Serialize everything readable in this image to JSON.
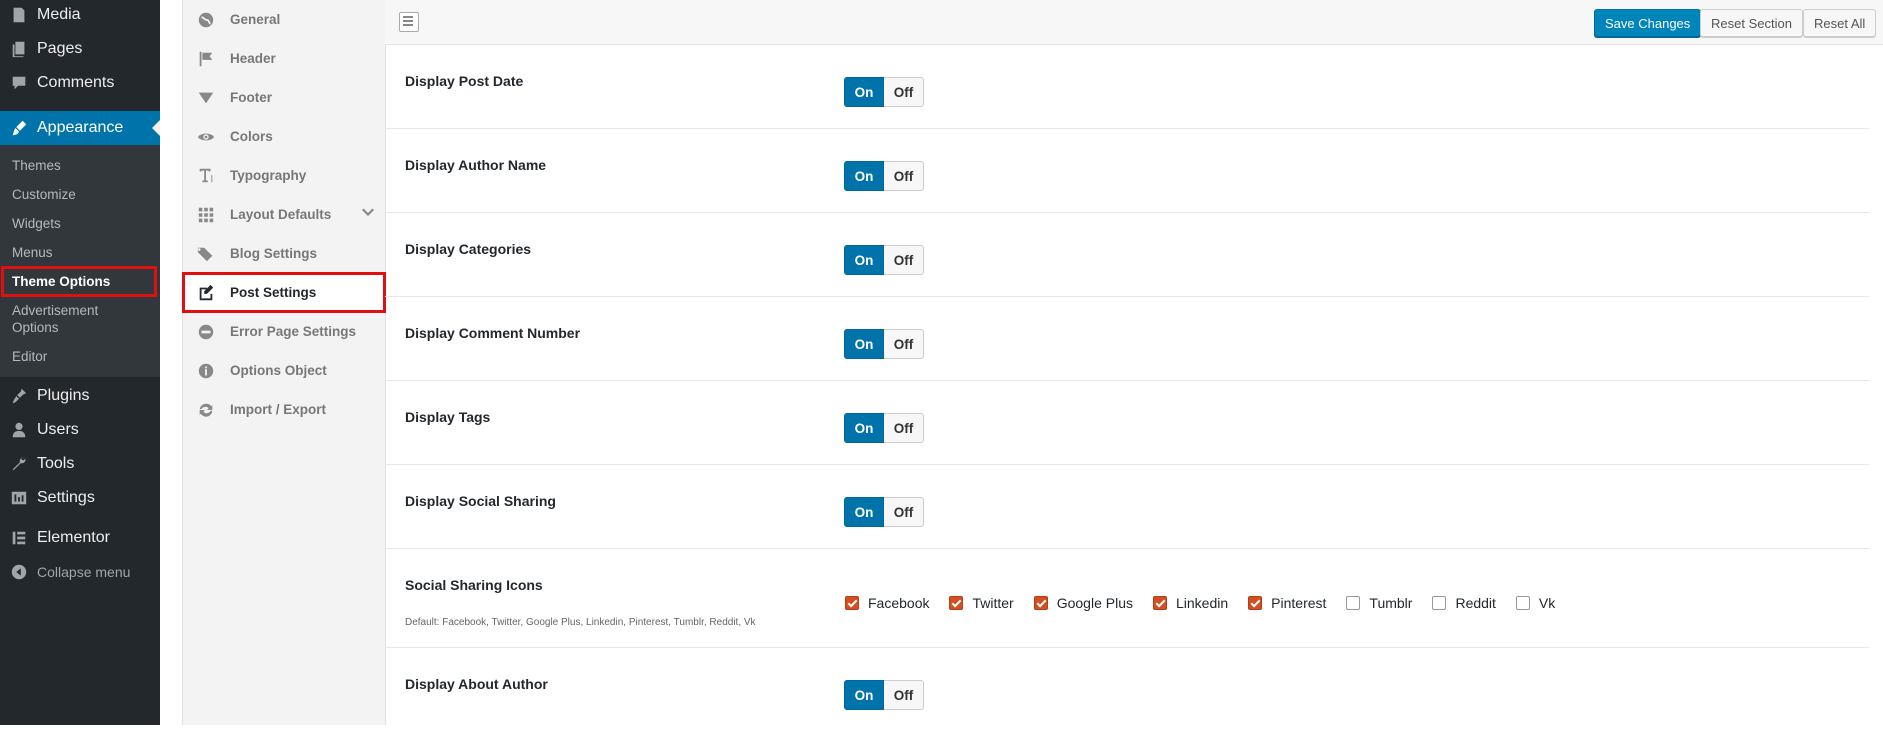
{
  "wp_menu": {
    "items_top": [
      {
        "label": "Media",
        "icon": "media-icon"
      },
      {
        "label": "Pages",
        "icon": "pages-icon"
      },
      {
        "label": "Comments",
        "icon": "comments-icon"
      }
    ],
    "active": {
      "label": "Appearance",
      "icon": "paintbrush-icon"
    },
    "submenu": [
      "Themes",
      "Customize",
      "Widgets",
      "Menus",
      "Theme Options",
      "Advertisement Options",
      "Editor"
    ],
    "submenu_current": "Theme Options",
    "items_bottom": [
      {
        "label": "Plugins",
        "icon": "plugin-icon"
      },
      {
        "label": "Users",
        "icon": "users-icon"
      },
      {
        "label": "Tools",
        "icon": "wrench-icon"
      },
      {
        "label": "Settings",
        "icon": "settings-icon"
      },
      {
        "label": "Elementor",
        "icon": "elementor-icon"
      }
    ],
    "collapse": "Collapse menu"
  },
  "options_nav": {
    "items": [
      {
        "label": "General",
        "icon": "globe-icon"
      },
      {
        "label": "Header",
        "icon": "flag-icon"
      },
      {
        "label": "Footer",
        "icon": "triangle-down-icon"
      },
      {
        "label": "Colors",
        "icon": "eye-icon"
      },
      {
        "label": "Typography",
        "icon": "text-icon"
      },
      {
        "label": "Layout Defaults",
        "icon": "grid-icon"
      },
      {
        "label": "Blog Settings",
        "icon": "tags-icon"
      },
      {
        "label": "Post Settings",
        "icon": "edit-icon"
      },
      {
        "label": "Error Page Settings",
        "icon": "minus-circle-icon"
      },
      {
        "label": "Options Object",
        "icon": "info-icon"
      },
      {
        "label": "Import / Export",
        "icon": "refresh-icon"
      }
    ],
    "active": "Post Settings"
  },
  "toolbar": {
    "save": "Save Changes",
    "reset_section": "Reset Section",
    "reset_all": "Reset All"
  },
  "switch_labels": {
    "on": "On",
    "off": "Off"
  },
  "settings": [
    {
      "label": "Display Post Date",
      "value": "On"
    },
    {
      "label": "Display Author Name",
      "value": "On"
    },
    {
      "label": "Display Categories",
      "value": "On"
    },
    {
      "label": "Display Comment Number",
      "value": "On"
    },
    {
      "label": "Display Tags",
      "value": "On"
    },
    {
      "label": "Display Social Sharing",
      "value": "On"
    }
  ],
  "social_icons": {
    "label": "Social Sharing Icons",
    "description": "Default: Facebook, Twitter, Google Plus, Linkedin, Pinterest, Tumblr, Reddit, Vk",
    "options": [
      {
        "label": "Facebook",
        "checked": true
      },
      {
        "label": "Twitter",
        "checked": true
      },
      {
        "label": "Google Plus",
        "checked": true
      },
      {
        "label": "Linkedin",
        "checked": true
      },
      {
        "label": "Pinterest",
        "checked": true
      },
      {
        "label": "Tumblr",
        "checked": false
      },
      {
        "label": "Reddit",
        "checked": false
      },
      {
        "label": "Vk",
        "checked": false
      }
    ]
  },
  "settings_after": [
    {
      "label": "Display About Author",
      "value": "On"
    }
  ],
  "colors": {
    "accent": "#0073aa",
    "highlight": "#e01010",
    "checkbox": "#d54e21"
  }
}
